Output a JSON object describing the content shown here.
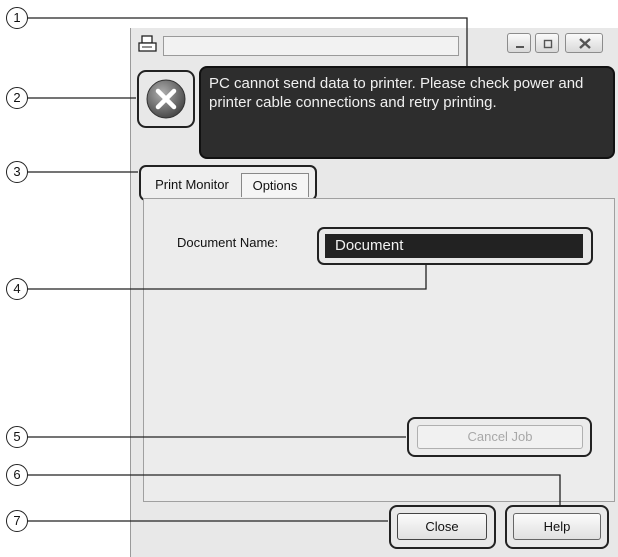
{
  "callouts": [
    "1",
    "2",
    "3",
    "4",
    "5",
    "6",
    "7"
  ],
  "window": {
    "title": "",
    "controls": [
      "minimize",
      "maximize",
      "close"
    ]
  },
  "error": {
    "icon": "error-x-icon",
    "message": "PC cannot send data to printer. Please check power and printer cable connections and retry printing."
  },
  "tabs": [
    {
      "label": "Print Monitor",
      "selected": true
    },
    {
      "label": "Options",
      "selected": false
    }
  ],
  "document": {
    "label": "Document Name:",
    "value": "Document"
  },
  "buttons": {
    "cancel_job": "Cancel Job",
    "close": "Close",
    "help": "Help"
  },
  "colors": {
    "message_bg": "#2d2d2d",
    "window_bg": "#e8e8e8",
    "disabled_text": "#a8a8a8"
  }
}
